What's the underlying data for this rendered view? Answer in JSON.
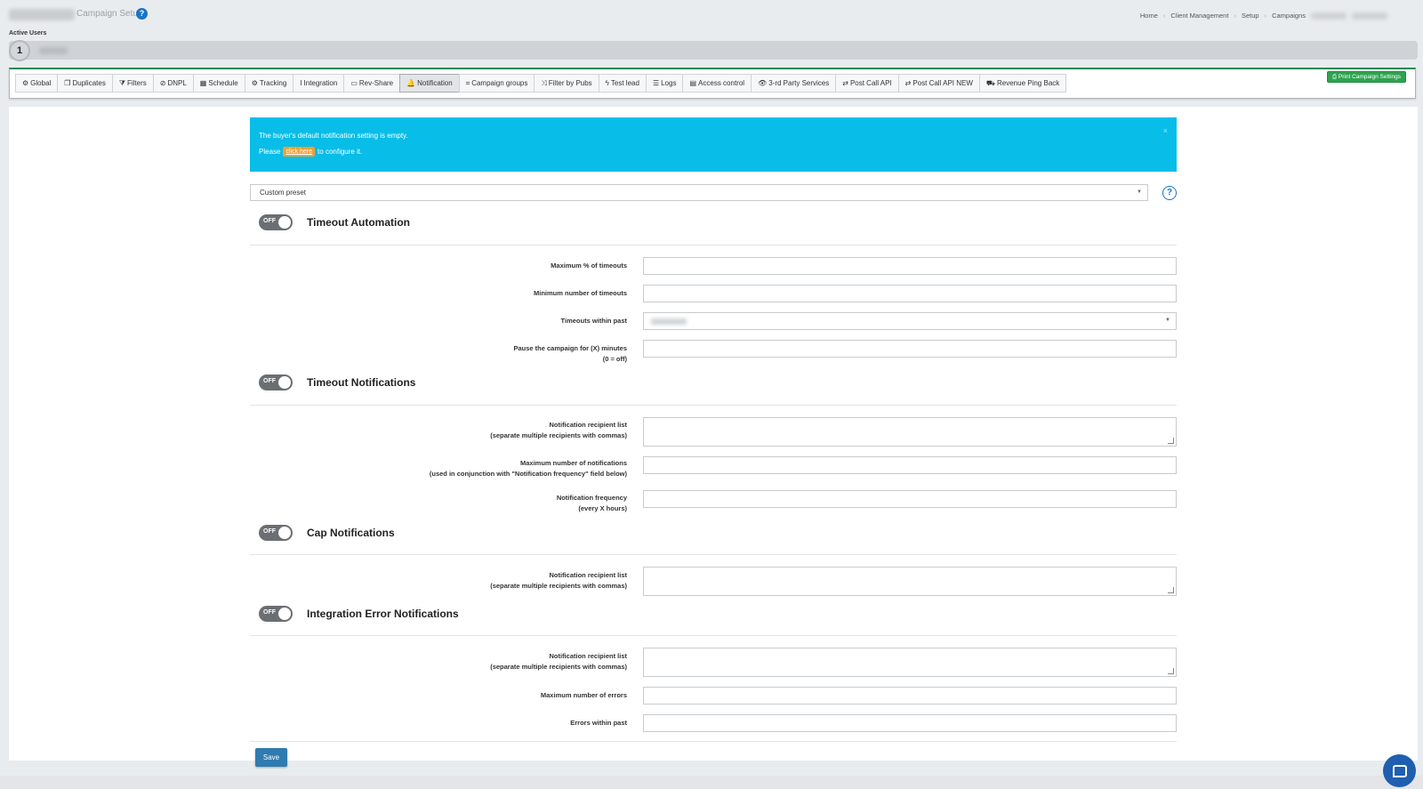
{
  "header": {
    "page_title": "Campaign Setup",
    "help_icon": "question-circle-icon",
    "breadcrumb": [
      "Home",
      "Client Management",
      "Setup",
      "Campaigns"
    ]
  },
  "users": {
    "section_label": "Active Users",
    "badge_number": "1"
  },
  "tabs": [
    {
      "icon": "⚙",
      "label": "Global"
    },
    {
      "icon": "❐",
      "label": "Duplicates"
    },
    {
      "icon": "⧩",
      "label": "Filters"
    },
    {
      "icon": "⊘",
      "label": "DNPL"
    },
    {
      "icon": "▦",
      "label": "Schedule"
    },
    {
      "icon": "⚙",
      "label": "Tracking"
    },
    {
      "icon": "I",
      "label": "Integration"
    },
    {
      "icon": "▭",
      "label": "Rev-Share"
    },
    {
      "icon": "🔔",
      "label": "Notification"
    },
    {
      "icon": "⌗",
      "label": "Campaign groups"
    },
    {
      "icon": "⤨",
      "label": "Filter by Pubs"
    },
    {
      "icon": "ϟ",
      "label": "Test lead"
    },
    {
      "icon": "☰",
      "label": "Logs"
    },
    {
      "icon": "▤",
      "label": "Access control"
    },
    {
      "icon": "👁",
      "label": "3-rd Party Services"
    },
    {
      "icon": "⇄",
      "label": "Post Call API"
    },
    {
      "icon": "⇄",
      "label": "Post Call API NEW"
    },
    {
      "icon": "⛟",
      "label": "Revenue Ping Back"
    }
  ],
  "active_tab": "Notification",
  "print_button": "Print Campaign Settings",
  "alert": {
    "line1": "The buyer's default notification setting is empty.",
    "line2_prefix": "Please",
    "link": "click here",
    "line2_suffix": "to configure it.",
    "close": "×"
  },
  "preset_select": {
    "value": "Custom preset"
  },
  "toggle_text": "OFF",
  "sections": {
    "timeout_automation": {
      "title": "Timeout Automation",
      "fields": [
        {
          "label": "Maximum % of timeouts",
          "value": ""
        },
        {
          "label": "Minimum number of timeouts",
          "value": ""
        },
        {
          "label": "Timeouts within past",
          "value": ""
        },
        {
          "label": "Pause the campaign for (X) minutes",
          "sub": "(0 = off)",
          "value": ""
        }
      ]
    },
    "timeout_notifications": {
      "title": "Timeout Notifications",
      "fields": [
        {
          "label": "Notification recipient list",
          "sub": "(separate multiple recipients with commas)"
        },
        {
          "label": "Maximum number of notifications",
          "sub": "(used in conjunction with \"Notification frequency\" field below)"
        },
        {
          "label": "Notification frequency",
          "sub": "(every X hours)"
        }
      ]
    },
    "cap_notifications": {
      "title": "Cap Notifications",
      "fields": [
        {
          "label": "Notification recipient list",
          "sub": "(separate multiple recipients with commas)"
        }
      ]
    },
    "integration_error_notifications": {
      "title": "Integration Error Notifications",
      "fields": [
        {
          "label": "Notification recipient list",
          "sub": "(separate multiple recipients with commas)"
        },
        {
          "label": "Maximum number of errors"
        },
        {
          "label": "Errors within past"
        }
      ]
    }
  },
  "save_button": "Save"
}
